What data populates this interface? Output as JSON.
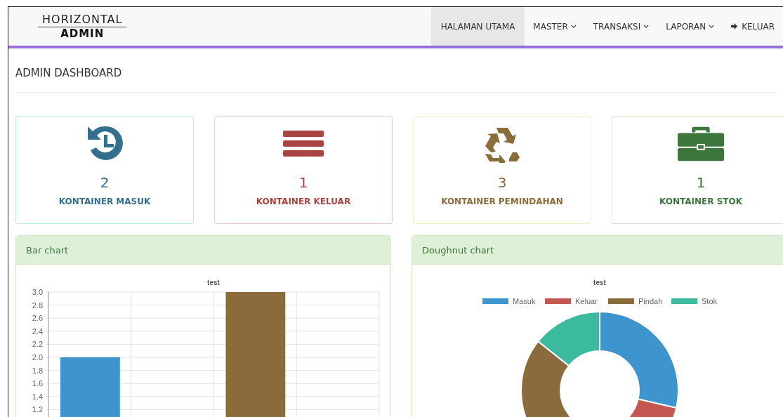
{
  "brand": {
    "top": "HORIZONTAL",
    "bottom": "ADMIN"
  },
  "nav": [
    {
      "label": "HALAMAN UTAMA",
      "selected": true,
      "dropdown": false,
      "kind": "text"
    },
    {
      "label": "MASTER",
      "selected": false,
      "dropdown": true,
      "kind": "text"
    },
    {
      "label": "TRANSAKSI",
      "selected": false,
      "dropdown": true,
      "kind": "text"
    },
    {
      "label": "LAPORAN",
      "selected": false,
      "dropdown": true,
      "kind": "text"
    },
    {
      "label": "KELUAR",
      "selected": false,
      "dropdown": false,
      "kind": "signout"
    }
  ],
  "page_title": "ADMIN DASHBOARD",
  "cards": [
    {
      "kind": "info",
      "count": "2",
      "label": "KONTAINER MASUK"
    },
    {
      "kind": "danger",
      "count": "1",
      "label": "KONTAINER KELUAR"
    },
    {
      "kind": "warning",
      "count": "3",
      "label": "KONTAINER PEMINDAHAN"
    },
    {
      "kind": "success",
      "count": "1",
      "label": "KONTAINER STOK"
    }
  ],
  "panels": [
    {
      "title": "Bar chart",
      "chart_data": {
        "type": "bar",
        "title": "test",
        "values": [
          2,
          null,
          3,
          null
        ],
        "colors": [
          "#3e95cd",
          null,
          "#8b6b3b",
          null
        ],
        "grid": true,
        "ylim": [
          1.2,
          3
        ],
        "yticks": [
          {
            "value": 1.2,
            "label": "1.2"
          },
          {
            "value": 1.4,
            "label": "1.4"
          },
          {
            "value": 1.6,
            "label": "1.6"
          },
          {
            "value": 1.8,
            "label": "1.8"
          },
          {
            "value": 2,
            "label": "2.0"
          },
          {
            "value": 2.2,
            "label": "2.2"
          },
          {
            "value": 2.4,
            "label": "2.4"
          },
          {
            "value": 2.6,
            "label": "2.6"
          },
          {
            "value": 2.8,
            "label": "2.8"
          },
          {
            "value": 3,
            "label": "3.0"
          }
        ]
      }
    },
    {
      "title": "Doughnut chart",
      "chart_data": {
        "type": "donut",
        "title": "test",
        "categories": [
          "Masuk",
          "Keluar",
          "Pindah",
          "Stok"
        ],
        "values": [
          28.6,
          14.3,
          42.8,
          14.3
        ],
        "colors": [
          "#3e95cd",
          "#c45850",
          "#8b6b3b",
          "#3cba9f"
        ],
        "legend": true
      }
    }
  ]
}
